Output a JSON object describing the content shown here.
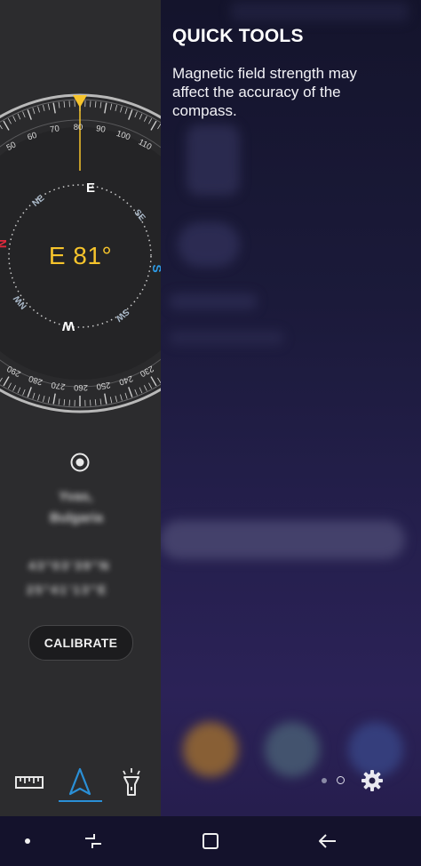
{
  "quick_tools": {
    "title": "QUICK TOOLS",
    "message": "Magnetic field strength may affect the accuracy of the compass."
  },
  "compass": {
    "heading": "E 81°",
    "degree_labels_top": [
      "50",
      "60",
      "70",
      "80",
      "90",
      "100",
      "110"
    ],
    "degree_labels_bottom": [
      "290",
      "280",
      "270",
      "260",
      "250",
      "240",
      "230"
    ],
    "cardinals": {
      "E": "E",
      "SE": "SE",
      "S": "S",
      "SW": "SW",
      "W": "W",
      "NW": "NW",
      "N": "N",
      "NE": "NE"
    },
    "north_color": "#e0283c",
    "south_color": "#2e9be6",
    "accent_color": "#f6c42c"
  },
  "location": {
    "city": "Yvas, ",
    "country": "Bulgaria",
    "latitude": "43°03'39\"N",
    "longitude": "25°41'13\"E"
  },
  "buttons": {
    "calibrate": "CALIBRATE"
  },
  "tabs": [
    {
      "name": "ruler",
      "icon": "ruler-icon"
    },
    {
      "name": "compass",
      "icon": "compass-arrow-icon",
      "active": true
    },
    {
      "name": "flashlight",
      "icon": "flashlight-icon"
    }
  ],
  "navbar": [
    "dot-icon",
    "recents-icon",
    "home-icon",
    "back-icon"
  ],
  "colors": {
    "panel": "#2c2c2e",
    "active_tab": "#2a8fd6"
  }
}
